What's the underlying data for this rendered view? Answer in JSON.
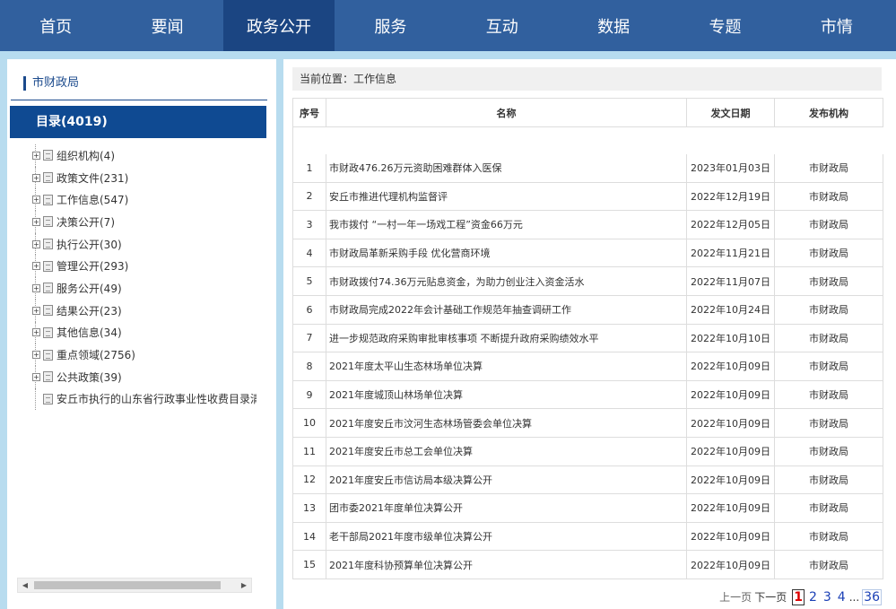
{
  "nav": {
    "items": [
      {
        "label": "首页"
      },
      {
        "label": "要闻"
      },
      {
        "label": "政务公开"
      },
      {
        "label": "服务"
      },
      {
        "label": "互动"
      },
      {
        "label": "数据"
      },
      {
        "label": "专题"
      },
      {
        "label": "市情"
      }
    ],
    "active_index": 2
  },
  "sidebar": {
    "dept": "市财政局",
    "catalog": "目录(4019)",
    "items": [
      {
        "label": "组织机构(4)"
      },
      {
        "label": "政策文件(231)"
      },
      {
        "label": "工作信息(547)"
      },
      {
        "label": "决策公开(7)"
      },
      {
        "label": "执行公开(30)"
      },
      {
        "label": "管理公开(293)"
      },
      {
        "label": "服务公开(49)"
      },
      {
        "label": "结果公开(23)"
      },
      {
        "label": "其他信息(34)"
      },
      {
        "label": "重点领域(2756)"
      },
      {
        "label": "公共政策(39)"
      },
      {
        "label": "安丘市执行的山东省行政事业性收费目录清单("
      }
    ]
  },
  "main": {
    "breadcrumb": "当前位置：工作信息",
    "headers": {
      "no": "序号",
      "name": "名称",
      "date": "发文日期",
      "org": "发布机构"
    },
    "rows": [
      {
        "no": "1",
        "name": "市财政476.26万元资助困难群体入医保",
        "date": "2023年01月03日",
        "org": "市财政局"
      },
      {
        "no": "2",
        "name": "安丘市推进代理机构监督评",
        "date": "2022年12月19日",
        "org": "市财政局"
      },
      {
        "no": "3",
        "name": "我市拨付 “一村一年一场戏工程”资金66万元",
        "date": "2022年12月05日",
        "org": "市财政局"
      },
      {
        "no": "4",
        "name": "市财政局革新采购手段 优化营商环境",
        "date": "2022年11月21日",
        "org": "市财政局"
      },
      {
        "no": "5",
        "name": "市财政拨付74.36万元贴息资金，为助力创业注入资金活水",
        "date": "2022年11月07日",
        "org": "市财政局"
      },
      {
        "no": "6",
        "name": "市财政局完成2022年会计基础工作规范年抽查调研工作",
        "date": "2022年10月24日",
        "org": "市财政局"
      },
      {
        "no": "7",
        "name": "进一步规范政府采购审批审核事项 不断提升政府采购绩效水平",
        "date": "2022年10月10日",
        "org": "市财政局"
      },
      {
        "no": "8",
        "name": "2021年度太平山生态林场单位决算",
        "date": "2022年10月09日",
        "org": "市财政局"
      },
      {
        "no": "9",
        "name": "2021年度城顶山林场单位决算",
        "date": "2022年10月09日",
        "org": "市财政局"
      },
      {
        "no": "10",
        "name": "2021年度安丘市汶河生态林场管委会单位决算",
        "date": "2022年10月09日",
        "org": "市财政局"
      },
      {
        "no": "11",
        "name": "2021年度安丘市总工会单位决算",
        "date": "2022年10月09日",
        "org": "市财政局"
      },
      {
        "no": "12",
        "name": "2021年度安丘市信访局本级决算公开",
        "date": "2022年10月09日",
        "org": "市财政局"
      },
      {
        "no": "13",
        "name": "团市委2021年度单位决算公开",
        "date": "2022年10月09日",
        "org": "市财政局"
      },
      {
        "no": "14",
        "name": "老干部局2021年度市级单位决算公开",
        "date": "2022年10月09日",
        "org": "市财政局"
      },
      {
        "no": "15",
        "name": "2021年度科协预算单位决算公开",
        "date": "2022年10月09日",
        "org": "市财政局"
      }
    ],
    "pager": {
      "prev": "上一页",
      "next": "下一页",
      "current": "1",
      "pages": [
        "2",
        "3",
        "4"
      ],
      "dots": "...",
      "last": "36"
    }
  }
}
